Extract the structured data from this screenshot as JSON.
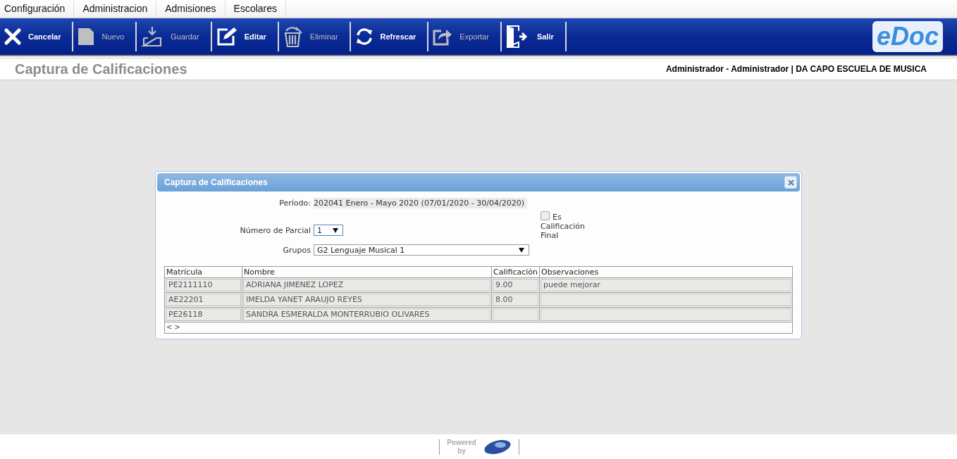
{
  "menu": [
    "Configuración",
    "Administracion",
    "Admisiones",
    "Escolares"
  ],
  "toolbar": [
    {
      "label": "Cancelar",
      "kind": "cancel",
      "disabled": false
    },
    {
      "label": "Nuevo",
      "kind": "new",
      "disabled": true
    },
    {
      "label": "Guardar",
      "kind": "save",
      "disabled": true
    },
    {
      "label": "Editar",
      "kind": "edit",
      "disabled": false
    },
    {
      "label": "Eliminar",
      "kind": "delete",
      "disabled": true
    },
    {
      "label": "Refrescar",
      "kind": "refresh",
      "disabled": false
    },
    {
      "label": "Exportar",
      "kind": "export",
      "disabled": true
    },
    {
      "label": "Salir",
      "kind": "exit",
      "disabled": false
    }
  ],
  "logo": "eDoc",
  "page_title": "Captura de Calificaciones",
  "user_info": "Administrador - Administrador | DA CAPO ESCUELA DE MUSICA",
  "dialog": {
    "title": "Captura de Calificaciones",
    "period_label": "Período:",
    "period_value": "202041 Enero - Mayo 2020 (07/01/2020 - 30/04/2020)",
    "partial_label": "Número de Parcial",
    "partial_value": "1",
    "final_checkbox": {
      "label_1": "Es",
      "label_2": "Calificación Final",
      "checked": false
    },
    "groups_label": "Grupos",
    "groups_value": "G2 Lenguaje Musical 1",
    "table": {
      "columns": [
        "Matrícula",
        "Nombre",
        "Calificación",
        "Observaciones"
      ],
      "rows": [
        [
          "PE2111110",
          "ADRIANA JIMENEZ LOPEZ",
          "9.00",
          "puede mejorar"
        ],
        [
          "AE22201",
          "IMELDA YANET ARAUJO REYES",
          "8.00",
          ""
        ],
        [
          "PE26118",
          "SANDRA ESMERALDA MONTERRUBIO OLIVARES",
          "",
          ""
        ]
      ],
      "pager": "< >"
    }
  },
  "footer": {
    "powered": "Powered",
    "by": "by"
  }
}
